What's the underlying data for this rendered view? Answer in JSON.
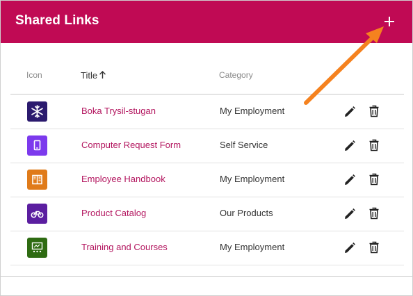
{
  "header": {
    "title": "Shared Links",
    "add_label": "+",
    "color": "#c00a54"
  },
  "table": {
    "columns": [
      "Icon",
      "Title",
      "Category"
    ],
    "sort_column": "Title",
    "sort_direction": "ascending",
    "rows": [
      {
        "icon": "snowflake-icon",
        "icon_color": "#2b1a6e",
        "title": "Boka Trysil-stugan",
        "category": "My Employment"
      },
      {
        "icon": "tablet-icon",
        "icon_color": "#7c3aed",
        "title": "Computer Request Form",
        "category": "Self Service"
      },
      {
        "icon": "book-icon",
        "icon_color": "#e07b1a",
        "title": "Employee Handbook",
        "category": "My Employment"
      },
      {
        "icon": "bicycle-icon",
        "icon_color": "#5b1ea0",
        "title": "Product Catalog",
        "category": "Our Products"
      },
      {
        "icon": "presentation-icon",
        "icon_color": "#2e6b12",
        "title": "Training and Courses",
        "category": "My Employment"
      }
    ]
  },
  "annotation": {
    "arrow_color": "#f5821f"
  }
}
